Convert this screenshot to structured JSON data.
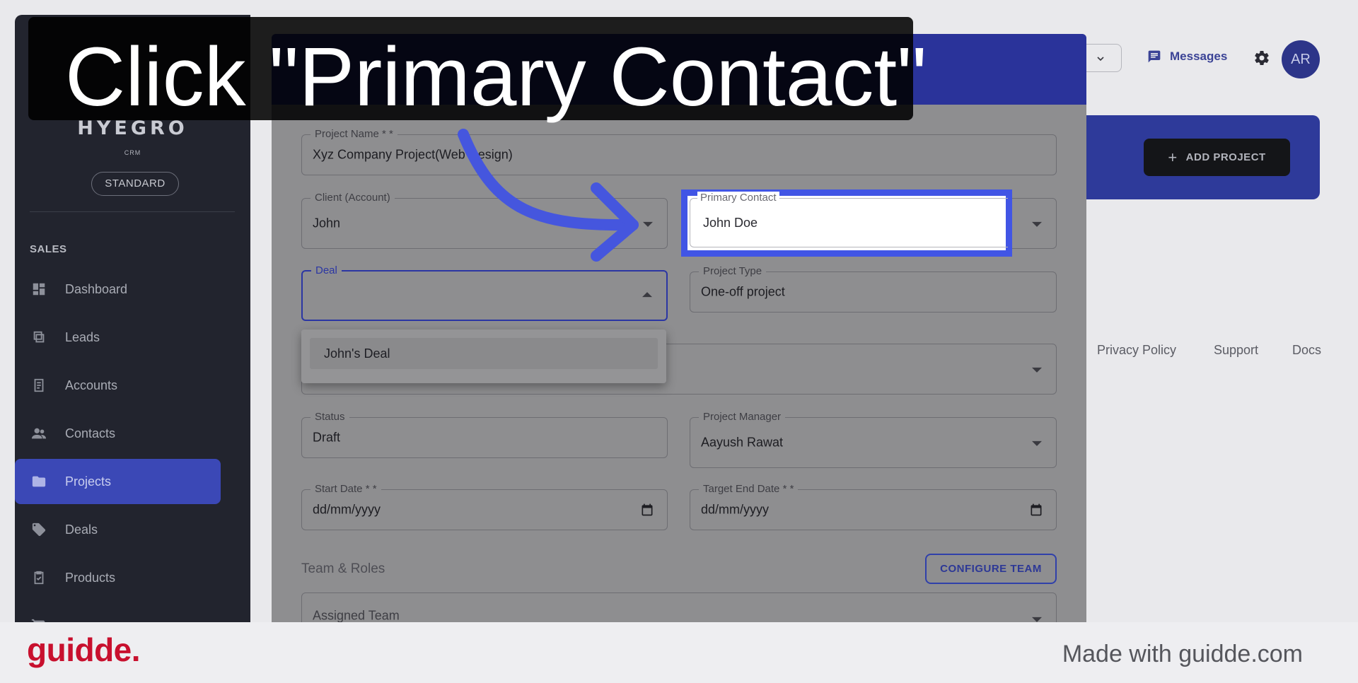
{
  "instruction": "Click \"Primary Contact\"",
  "app": {
    "logo": "HYEGRO",
    "logo_sub": "CRM",
    "plan": "STANDARD",
    "section_title": "SALES",
    "nav": [
      {
        "label": "Dashboard",
        "icon": "dashboard-icon",
        "active": false
      },
      {
        "label": "Leads",
        "icon": "leads-icon",
        "active": false
      },
      {
        "label": "Accounts",
        "icon": "accounts-icon",
        "active": false
      },
      {
        "label": "Contacts",
        "icon": "contacts-icon",
        "active": false
      },
      {
        "label": "Projects",
        "icon": "folder-icon",
        "active": true
      },
      {
        "label": "Deals",
        "icon": "tag-icon",
        "active": false
      },
      {
        "label": "Products",
        "icon": "clipboard-icon",
        "active": false
      },
      {
        "label": "",
        "icon": "cart-icon",
        "active": false
      }
    ],
    "messages_label": "Messages",
    "avatar_initials": "AR",
    "add_project_label": "ADD PROJECT",
    "footer_links": [
      "Privacy Policy",
      "Support",
      "Docs"
    ]
  },
  "modal": {
    "header_title": "",
    "project_name": {
      "label": "Project Name * *",
      "value": "Xyz Company Project(Web Design)"
    },
    "client": {
      "label": "Client (Account)",
      "value": "John"
    },
    "primary_contact": {
      "label": "Primary Contact",
      "value": "John Doe"
    },
    "deal": {
      "label": "Deal",
      "value": ""
    },
    "deal_options": [
      "John's Deal"
    ],
    "project_type": {
      "label": "Project Type",
      "value": "One-off project"
    },
    "status": {
      "label": "Status",
      "value": "Draft"
    },
    "project_manager": {
      "label": "Project Manager",
      "value": "Aayush Rawat"
    },
    "start_date": {
      "label": "Start Date * *",
      "value": "dd/mm/yyyy"
    },
    "target_end_date": {
      "label": "Target End Date * *",
      "value": "dd/mm/yyyy"
    },
    "team_section": "Team & Roles",
    "configure_team_label": "CONFIGURE TEAM",
    "assigned_team_placeholder": "Assigned Team"
  },
  "footer": {
    "brand": "guidde.",
    "made_with": "Made with guidde.com"
  },
  "colors": {
    "accent": "#4155e5",
    "brand_red": "#c8102e",
    "sidebar": "#22242e"
  }
}
